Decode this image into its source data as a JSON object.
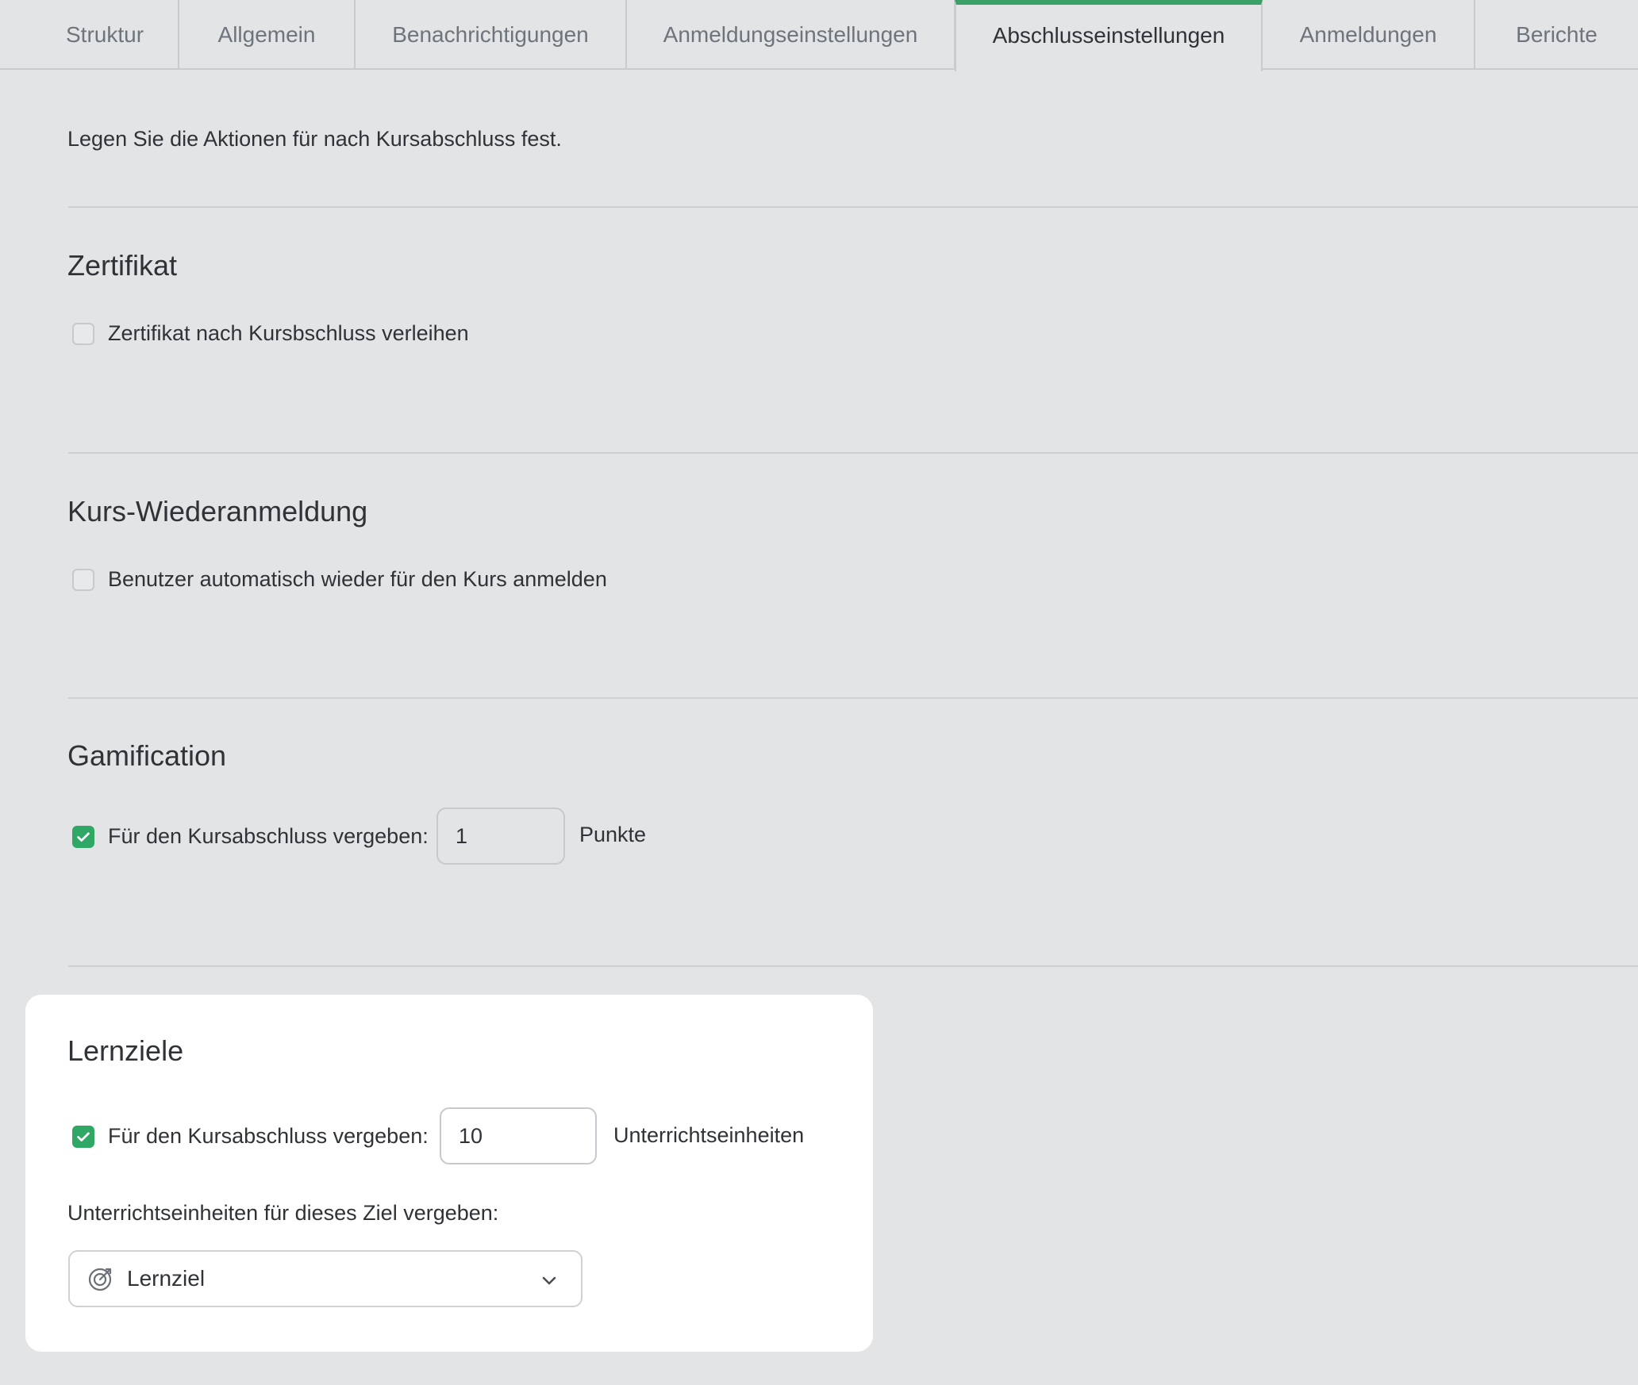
{
  "tabs": [
    {
      "label": "Struktur"
    },
    {
      "label": "Allgemein"
    },
    {
      "label": "Benachrichtigungen"
    },
    {
      "label": "Anmeldungseinstellungen"
    },
    {
      "label": "Abschlusseinstellungen",
      "active": true
    },
    {
      "label": "Anmeldungen"
    },
    {
      "label": "Berichte"
    }
  ],
  "intro": "Legen Sie die Aktionen für nach Kursabschluss fest.",
  "certificate": {
    "title": "Zertifikat",
    "checkbox_label": "Zertifikat nach Kursbschluss verleihen",
    "checked": false
  },
  "reenroll": {
    "title": "Kurs-Wiederanmeldung",
    "checkbox_label": "Benutzer automatisch wieder für den Kurs anmelden",
    "checked": false
  },
  "gamification": {
    "title": "Gamification",
    "checkbox_label": "Für den Kursabschluss vergeben:",
    "checked": true,
    "value": "1",
    "unit": "Punkte"
  },
  "learning_goals": {
    "title": "Lernziele",
    "checkbox_label": "Für den Kursabschluss vergeben:",
    "checked": true,
    "value": "10",
    "unit": "Unterrichtseinheiten",
    "goal_label": "Unterrichtseinheiten für dieses Ziel vergeben:",
    "select_value": "Lernziel",
    "select_icon": "target-icon"
  },
  "colors": {
    "accent": "#3aa066",
    "checkbox_checked": "#2fa866",
    "background": "#e3e4e6",
    "card": "#ffffff"
  }
}
